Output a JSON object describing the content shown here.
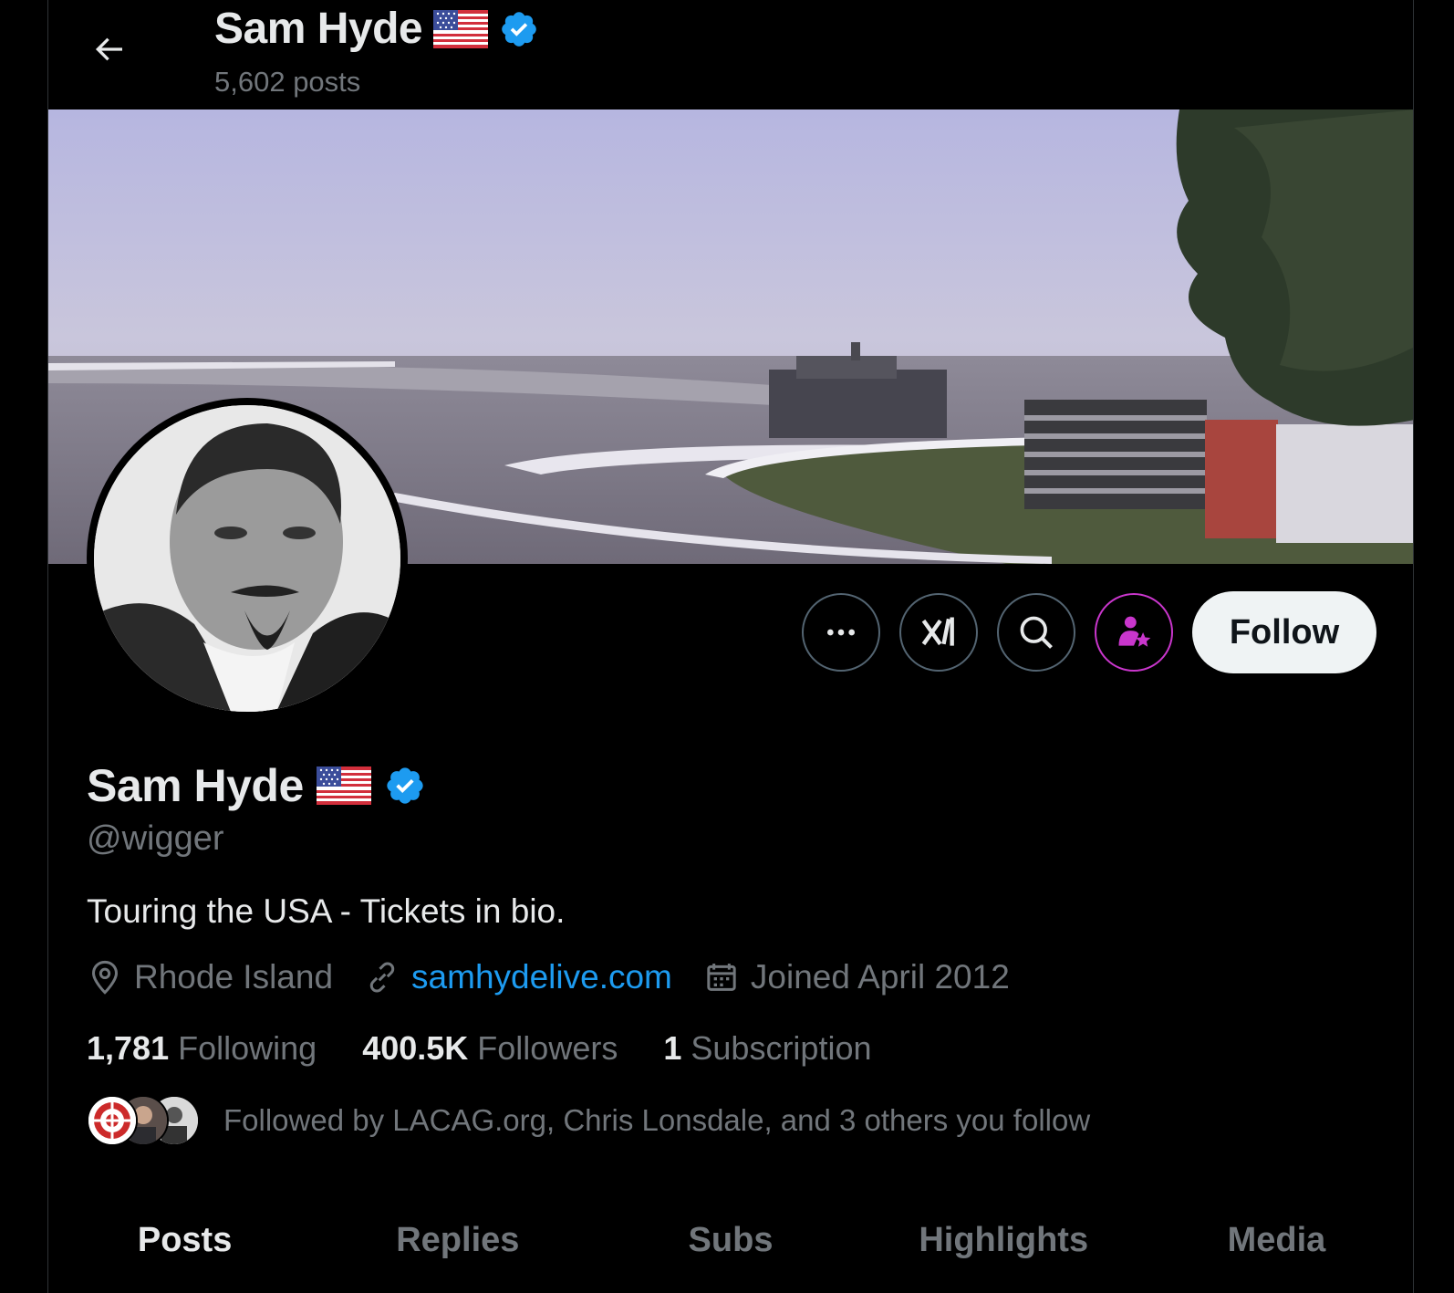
{
  "header": {
    "name": "Sam Hyde",
    "posts_count": "5,602 posts"
  },
  "profile": {
    "name": "Sam Hyde",
    "handle": "@wigger",
    "bio": "Touring the USA - Tickets in bio.",
    "location": "Rhode Island",
    "website": "samhydelive.com",
    "joined": "Joined April 2012"
  },
  "stats": {
    "following_count": "1,781",
    "following_label": "Following",
    "followers_count": "400.5K",
    "followers_label": "Followers",
    "subscription_count": "1",
    "subscription_label": "Subscription"
  },
  "followed_by": "Followed by LACAG.org, Chris Lonsdale, and 3 others you follow",
  "actions": {
    "follow_label": "Follow"
  },
  "tabs": [
    {
      "label": "Posts",
      "active": true
    },
    {
      "label": "Replies",
      "active": false
    },
    {
      "label": "Subs",
      "active": false
    },
    {
      "label": "Highlights",
      "active": false
    },
    {
      "label": "Media",
      "active": false
    }
  ],
  "colors": {
    "background": "#000000",
    "text_primary": "#e7e9ea",
    "text_secondary": "#71767b",
    "accent_blue": "#1d9bf0",
    "verified_blue": "#1d9bf0",
    "subscribe_magenta": "#c936cc",
    "follow_button_bg": "#eff3f4"
  },
  "icons": {
    "back": "arrow-left-icon",
    "verified": "verified-badge-icon",
    "flag": "us-flag-icon",
    "more": "more-icon",
    "grok": "grok-icon",
    "search": "search-icon",
    "subscribe": "subscribe-person-star-icon",
    "location": "location-pin-icon",
    "link": "link-icon",
    "calendar": "calendar-icon"
  }
}
